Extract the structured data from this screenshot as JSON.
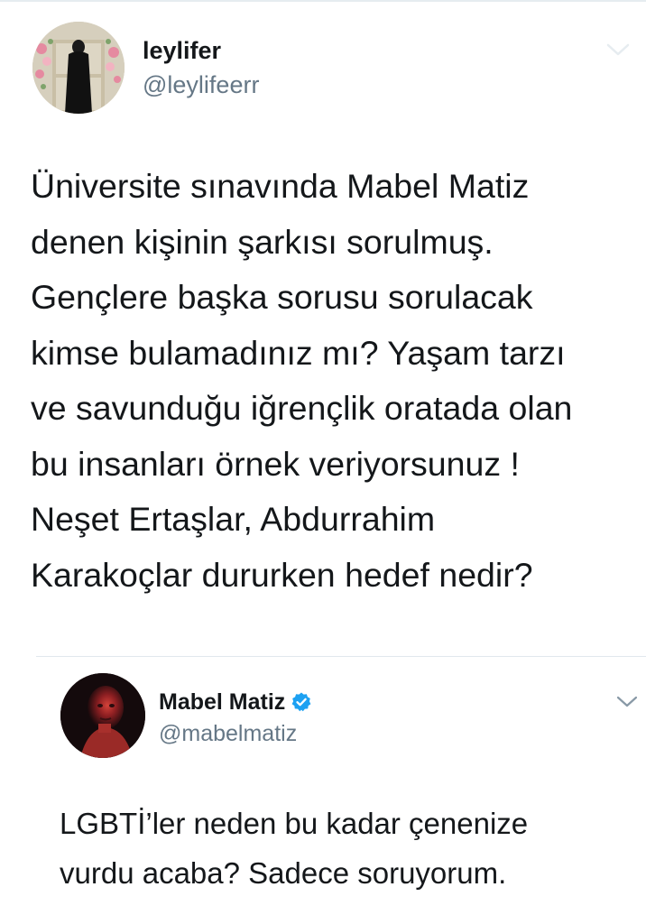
{
  "tweet": {
    "author": {
      "name": "leylifer",
      "handle": "@leylifeerr",
      "avatar": "woman-in-hijab-avatar"
    },
    "text_lines": [
      "Üniversite sınavında Mabel Matiz",
      "denen kişinin şarkısı sorulmuş.",
      "Gençlere başka sorusu sorulacak",
      "kimse bulamadınız mı? Yaşam tarzı",
      "ve savunduğu iğrençlik oratada olan",
      "bu insanları örnek veriyorsunuz !",
      "Neşet Ertaşlar, Abdurrahim",
      "Karakoçlar dururken hedef nedir?"
    ]
  },
  "quoted_tweet": {
    "author": {
      "name": "Mabel Matiz",
      "handle": "@mabelmatiz",
      "verified": true,
      "avatar": "man-red-lit-portrait-avatar"
    },
    "text_lines": [
      "LGBTİ’ler neden bu kadar çenenize",
      "vurdu acaba? Sadece soruyorum."
    ]
  },
  "colors": {
    "text_primary": "#14171a",
    "text_secondary": "#657786",
    "divider": "#e1e8ed",
    "verified_blue": "#1da1f2",
    "chevron_gray": "#8899a6"
  },
  "icons": {
    "verified": "verified-badge-icon",
    "chevron": "chevron-down-icon"
  }
}
